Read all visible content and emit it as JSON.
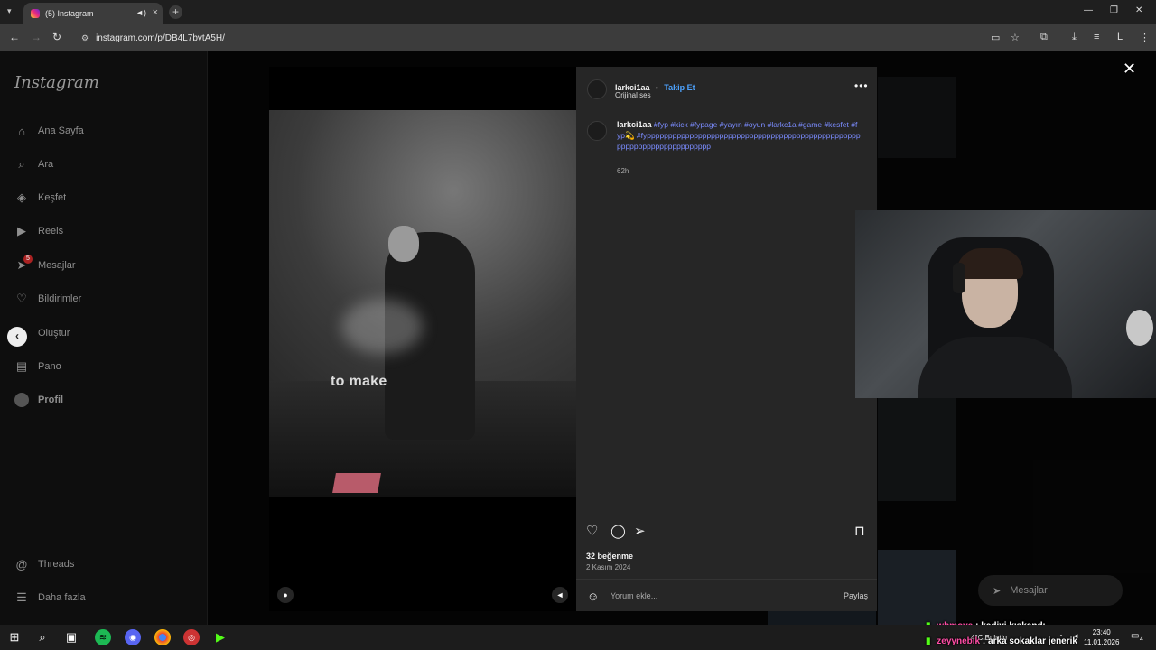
{
  "browser": {
    "tab_title": "(5) Instagram",
    "url": "instagram.com/p/DB4L7bvtA5H/"
  },
  "sidebar": {
    "logo": "Instagram",
    "items": [
      {
        "label": "Ana Sayfa",
        "icon": "home-icon"
      },
      {
        "label": "Ara",
        "icon": "search-icon"
      },
      {
        "label": "Keşfet",
        "icon": "compass-icon"
      },
      {
        "label": "Reels",
        "icon": "reels-icon"
      },
      {
        "label": "Mesajlar",
        "icon": "messenger-icon",
        "badge": "5"
      },
      {
        "label": "Bildirimler",
        "icon": "heart-icon"
      },
      {
        "label": "Oluştur",
        "icon": "plus-icon"
      },
      {
        "label": "Pano",
        "icon": "dashboard-icon"
      },
      {
        "label": "Profil",
        "icon": "avatar"
      }
    ],
    "bottom": [
      {
        "label": "Threads",
        "icon": "threads-icon"
      },
      {
        "label": "Daha fazla",
        "icon": "menu-icon"
      }
    ]
  },
  "post": {
    "username": "larkci1aa",
    "follow_label": "Takip Et",
    "separator": "•",
    "audio": "Orijinal ses",
    "caption_user": "larkci1aa",
    "caption_tags": "#fyp #kick #fypage #yayın #oyun #larkc1a #game #kesfet #fyp💫 #fypppppppppppppppppppppppppppppppppppppppppppppppppppppppppppppppppppppppp",
    "caption_time": "62h",
    "video_text": "to make",
    "likes": "32 beğenme",
    "date": "2 Kasım 2024",
    "comment_placeholder": "Yorum ekle...",
    "share_label": "Paylaş"
  },
  "overlay_pill": {
    "label": "Mesajlar"
  },
  "chat": [
    {
      "user": "whmova",
      "sep": ":",
      "text": "kediyi kıskandı."
    },
    {
      "user": "zeyynebik",
      "sep": ":",
      "text": "arka sokaklar jenerik"
    }
  ],
  "taskbar": {
    "weather": "4°C Bulutlu",
    "time": "23:40",
    "date": "11.01.2026",
    "notif_count": "4"
  },
  "colors": {
    "link_blue": "#4da3ff",
    "hashtag": "#7b8cff",
    "panel_bg": "#262626",
    "kick_green": "#53fc18"
  }
}
